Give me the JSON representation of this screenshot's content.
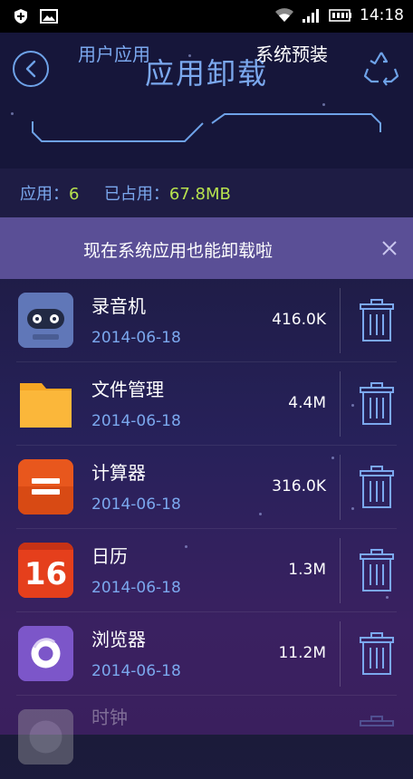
{
  "status_bar": {
    "time": "14:18",
    "icons": [
      "shield-icon",
      "image-icon",
      "wifi-icon",
      "signal-icon",
      "battery-icon"
    ]
  },
  "header": {
    "title": "应用卸载"
  },
  "tabs": [
    {
      "label": "用户应用",
      "active": false
    },
    {
      "label": "系统预装",
      "active": true
    }
  ],
  "stats": {
    "apps_label": "应用：",
    "apps_count": "6",
    "used_label": "已占用：",
    "used_size": "67.8MB"
  },
  "banner": {
    "text": "现在系统应用也能卸载啦"
  },
  "apps": [
    {
      "name": "录音机",
      "date": "2014-06-18",
      "size": "416.0K",
      "icon": "recorder-icon"
    },
    {
      "name": "文件管理",
      "date": "2014-06-18",
      "size": "4.4M",
      "icon": "folder-icon"
    },
    {
      "name": "计算器",
      "date": "2014-06-18",
      "size": "316.0K",
      "icon": "calculator-icon"
    },
    {
      "name": "日历",
      "date": "2014-06-18",
      "size": "1.3M",
      "icon": "calendar-icon",
      "icon_text": "16"
    },
    {
      "name": "浏览器",
      "date": "2014-06-18",
      "size": "11.2M",
      "icon": "browser-icon"
    },
    {
      "name": "时钟",
      "date": "",
      "size": "",
      "icon": "clock-icon"
    }
  ],
  "colors": {
    "accent": "#7ba8ee",
    "highlight": "#b7e24e",
    "banner": "#5a4f96"
  }
}
